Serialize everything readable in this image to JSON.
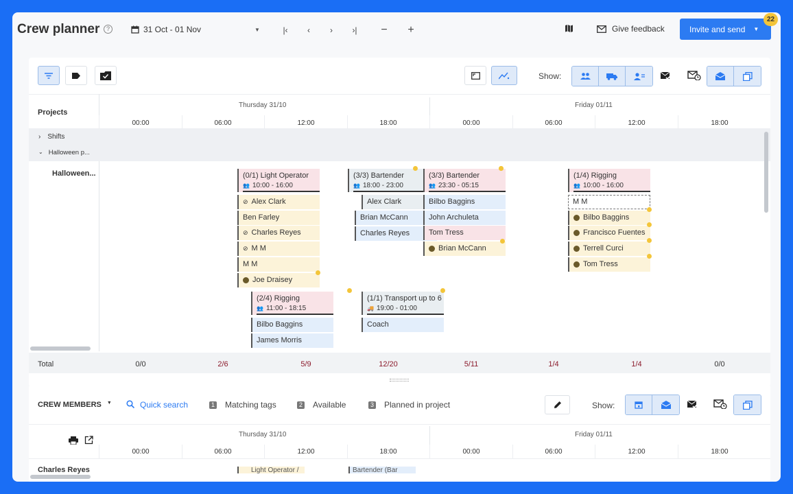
{
  "header": {
    "title": "Crew planner",
    "help": "?",
    "date_range": "31 Oct - 01 Nov",
    "give_feedback": "Give feedback",
    "invite_label": "Invite and send",
    "badge_count": "22"
  },
  "toolbar": {
    "show_label": "Show:"
  },
  "projects": {
    "header": "Projects",
    "day1": "Thursday 31/10",
    "day2": "Friday 01/11",
    "hours": [
      "00:00",
      "06:00",
      "12:00",
      "18:00",
      "00:00",
      "06:00",
      "12:00",
      "18:00"
    ],
    "tree": {
      "shifts": "Shifts",
      "halloween_group": "Halloween p...",
      "halloween_row": "Halloween..."
    }
  },
  "cards": [
    {
      "title": "(0/1) Light Operator",
      "time": "10:00 - 16:00"
    },
    {
      "title": "(3/3) Bartender",
      "time": "18:00 - 23:00"
    },
    {
      "title": "(3/3) Bartender",
      "time": "23:30 - 05:15"
    },
    {
      "title": "(1/4) Rigging",
      "time": "10:00 - 16:00"
    },
    {
      "title": "(2/4) Rigging",
      "time": "11:00 - 18:15"
    },
    {
      "title": "(1/1) Transport up to 6",
      "time": "19:00 - 01:00"
    }
  ],
  "people": {
    "light": [
      "Alex Clark",
      "Ben Farley",
      "Charles Reyes",
      "M M",
      "M M",
      "Joe Draisey"
    ],
    "bar1": [
      "Alex Clark",
      "Brian McCann",
      "Charles Reyes"
    ],
    "bar2": [
      "Bilbo Baggins",
      "John Archuleta",
      "Tom Tress",
      "Brian McCann"
    ],
    "rig1": [
      "M M",
      "Bilbo Baggins",
      "Francisco Fuentes",
      "Terrell Curci",
      "Tom Tress"
    ],
    "rig2": [
      "Bilbo Baggins",
      "James Morris"
    ],
    "transport": [
      "Coach"
    ]
  },
  "totals": {
    "label": "Total",
    "values": [
      "0/0",
      "2/6",
      "5/9",
      "12/20",
      "5/11",
      "1/4",
      "1/4",
      "0/0"
    ]
  },
  "crew": {
    "label": "CREW MEMBERS",
    "quick_search": "Quick search",
    "filters": [
      {
        "num": "1",
        "label": "Matching tags"
      },
      {
        "num": "2",
        "label": "Available"
      },
      {
        "num": "3",
        "label": "Planned in project"
      }
    ],
    "show_label": "Show:",
    "first_member": "Charles Reyes",
    "peek1": "Light Operator /",
    "peek2": "Bartender (Bar"
  },
  "colors": {
    "brand": "#2c7bf2",
    "frame": "#1a6ef5",
    "badge": "#f3c53a"
  }
}
